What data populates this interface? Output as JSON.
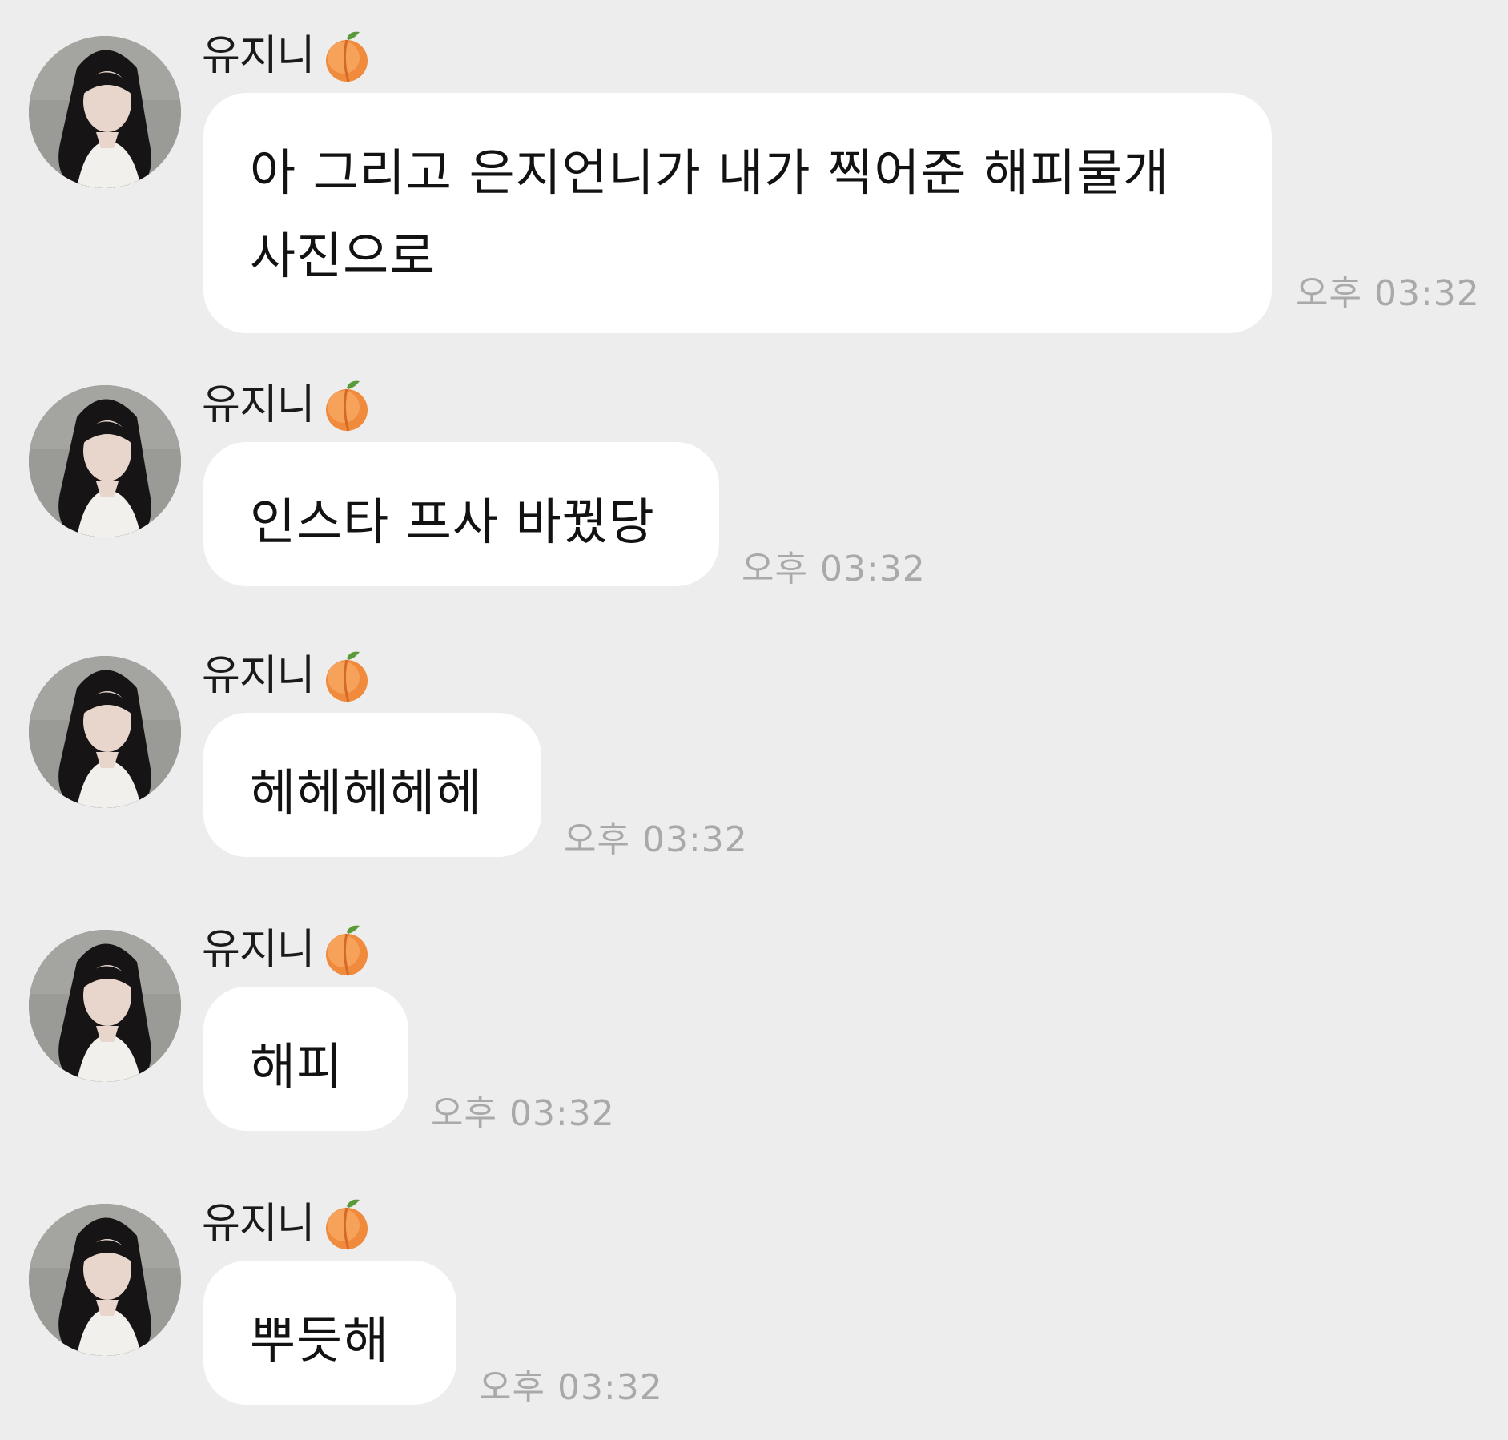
{
  "chat": {
    "messages": [
      {
        "sender": "유지니",
        "sender_emoji": "peach-icon",
        "text": "아 그리고 은지언니가 내가 찍어준 해피물개 사진으로",
        "time": "오후 03:32"
      },
      {
        "sender": "유지니",
        "sender_emoji": "peach-icon",
        "text": "인스타 프사 바꿨당",
        "time": "오후 03:32"
      },
      {
        "sender": "유지니",
        "sender_emoji": "peach-icon",
        "text": "헤헤헤헤헤",
        "time": "오후 03:32"
      },
      {
        "sender": "유지니",
        "sender_emoji": "peach-icon",
        "text": "해피",
        "time": "오후 03:32"
      },
      {
        "sender": "유지니",
        "sender_emoji": "peach-icon",
        "text": "뿌듯해",
        "time": "오후 03:32"
      }
    ]
  },
  "colors": {
    "background": "#ededed",
    "bubble": "#ffffff",
    "text": "#121212",
    "timestamp": "#a9a9a9"
  }
}
